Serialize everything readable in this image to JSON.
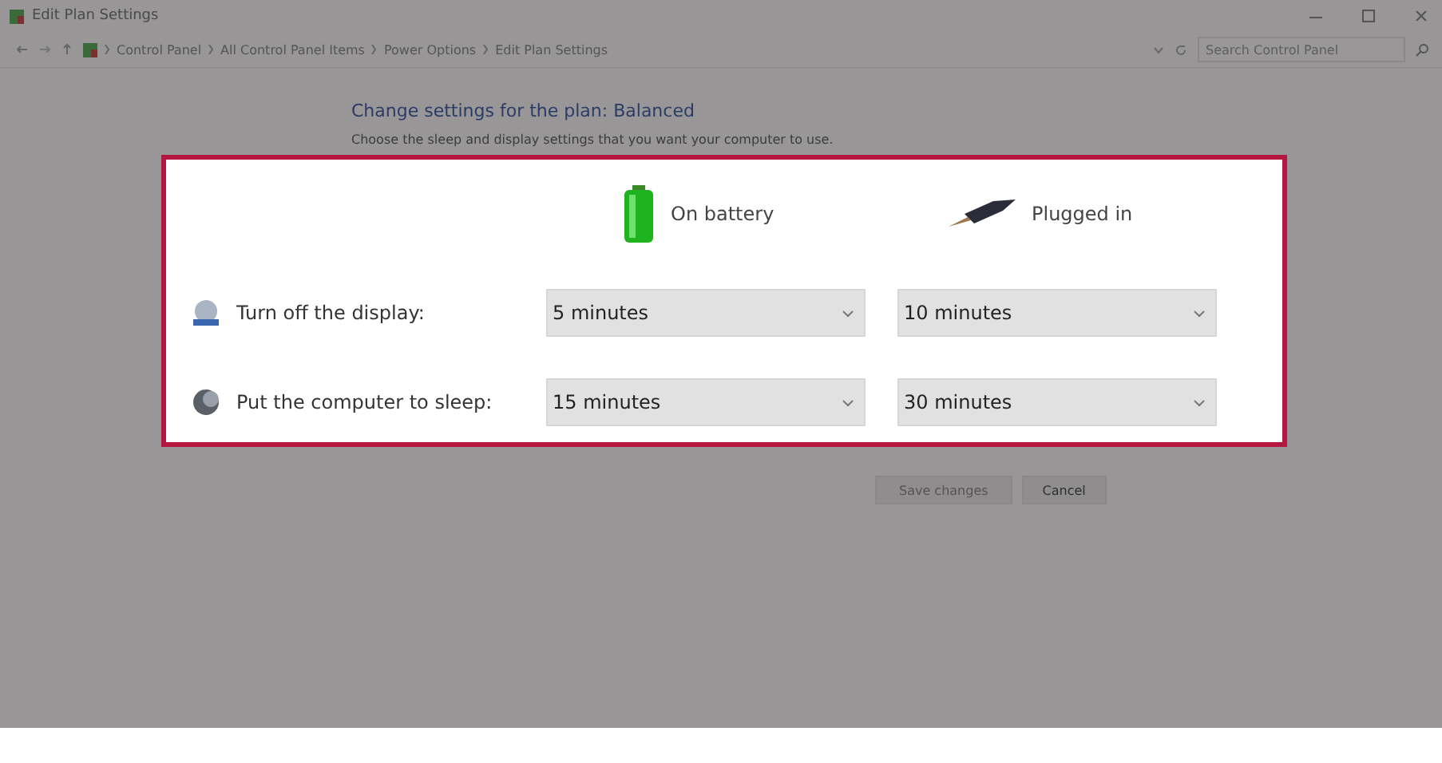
{
  "window": {
    "title": "Edit Plan Settings"
  },
  "address_bar": {
    "path": [
      "Control Panel",
      "All Control Panel Items",
      "Power Options",
      "Edit Plan Settings"
    ],
    "search": {
      "placeholder": "Search Control Panel"
    }
  },
  "heading": "Change settings for the plan: Balanced",
  "description": "Choose the sleep and display settings that you want your computer to use.",
  "columns": [
    {
      "label": "On battery",
      "kind": "battery"
    },
    {
      "label": "Plugged in",
      "kind": "plug"
    }
  ],
  "settings": [
    {
      "label": "Turn off the display:",
      "kind": "display",
      "values": [
        "5 minutes",
        "10 minutes"
      ]
    },
    {
      "label": "Put the computer to sleep:",
      "kind": "sleep",
      "values": [
        "15 minutes",
        "30 minutes"
      ]
    }
  ],
  "buttons": [
    {
      "label": "Save changes",
      "disabled": true
    },
    {
      "label": "Cancel",
      "disabled": false
    }
  ]
}
